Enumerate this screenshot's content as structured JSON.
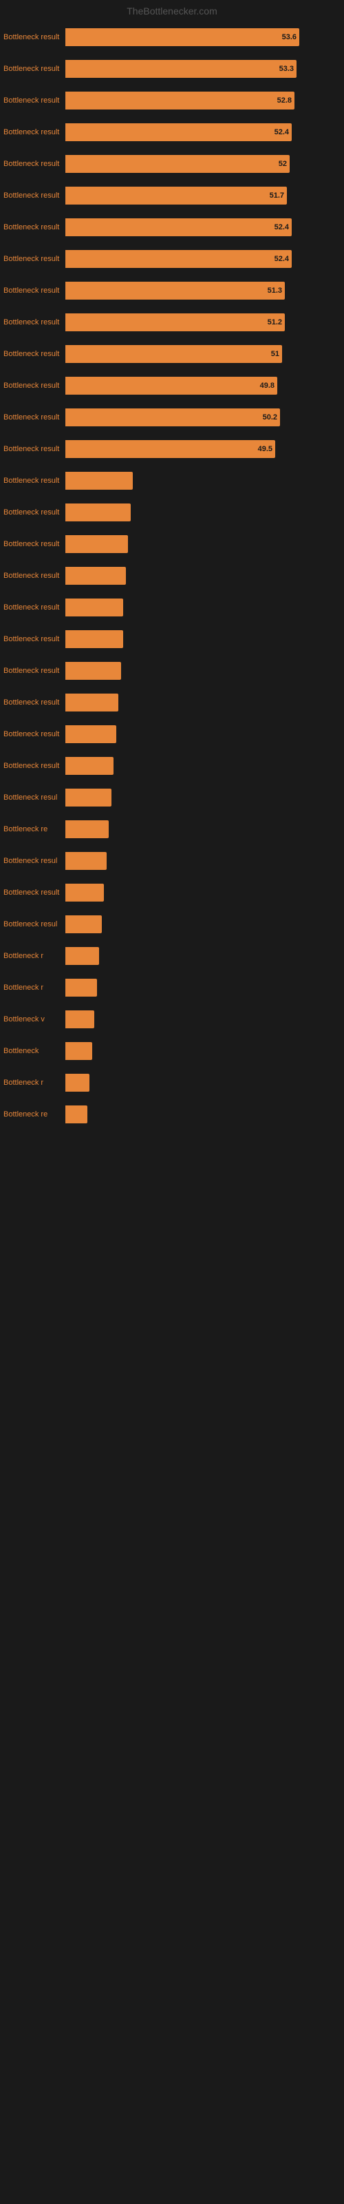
{
  "header": {
    "title": "TheBottlenecker.com"
  },
  "chart": {
    "max_width": 350,
    "bars": [
      {
        "label": "Bottleneck result",
        "value": 53.6,
        "width_pct": 0.97
      },
      {
        "label": "Bottleneck result",
        "value": 53.3,
        "width_pct": 0.96
      },
      {
        "label": "Bottleneck result",
        "value": 52.8,
        "width_pct": 0.95
      },
      {
        "label": "Bottleneck result",
        "value": 52.4,
        "width_pct": 0.94
      },
      {
        "label": "Bottleneck result",
        "value": 52.0,
        "width_pct": 0.93
      },
      {
        "label": "Bottleneck result",
        "value": 51.7,
        "width_pct": 0.92
      },
      {
        "label": "Bottleneck result",
        "value": 52.4,
        "width_pct": 0.94
      },
      {
        "label": "Bottleneck result",
        "value": 52.4,
        "width_pct": 0.94
      },
      {
        "label": "Bottleneck result",
        "value": 51.3,
        "width_pct": 0.91
      },
      {
        "label": "Bottleneck result",
        "value": 51.2,
        "width_pct": 0.91
      },
      {
        "label": "Bottleneck result",
        "value": 51.0,
        "width_pct": 0.9
      },
      {
        "label": "Bottleneck result",
        "value": 49.8,
        "width_pct": 0.88
      },
      {
        "label": "Bottleneck result",
        "value": 50.2,
        "width_pct": 0.89
      },
      {
        "label": "Bottleneck result",
        "value": 49.5,
        "width_pct": 0.87
      },
      {
        "label": "Bottleneck result",
        "value": null,
        "width_pct": 0.28
      },
      {
        "label": "Bottleneck result",
        "value": null,
        "width_pct": 0.27
      },
      {
        "label": "Bottleneck result",
        "value": null,
        "width_pct": 0.26
      },
      {
        "label": "Bottleneck result",
        "value": null,
        "width_pct": 0.25
      },
      {
        "label": "Bottleneck result",
        "value": null,
        "width_pct": 0.24
      },
      {
        "label": "Bottleneck result",
        "value": null,
        "width_pct": 0.24
      },
      {
        "label": "Bottleneck result",
        "value": null,
        "width_pct": 0.23
      },
      {
        "label": "Bottleneck result",
        "value": null,
        "width_pct": 0.22
      },
      {
        "label": "Bottleneck result",
        "value": null,
        "width_pct": 0.21
      },
      {
        "label": "Bottleneck result",
        "value": null,
        "width_pct": 0.2
      },
      {
        "label": "Bottleneck resul",
        "value": null,
        "width_pct": 0.19
      },
      {
        "label": "Bottleneck re",
        "value": null,
        "width_pct": 0.18
      },
      {
        "label": "Bottleneck resul",
        "value": null,
        "width_pct": 0.17
      },
      {
        "label": "Bottleneck result",
        "value": null,
        "width_pct": 0.16
      },
      {
        "label": "Bottleneck resul",
        "value": null,
        "width_pct": 0.15
      },
      {
        "label": "Bottleneck r",
        "value": null,
        "width_pct": 0.14
      },
      {
        "label": "Bottleneck r",
        "value": null,
        "width_pct": 0.13
      },
      {
        "label": "Bottleneck v",
        "value": null,
        "width_pct": 0.12
      },
      {
        "label": "Bottleneck",
        "value": null,
        "width_pct": 0.11
      },
      {
        "label": "Bottleneck r",
        "value": null,
        "width_pct": 0.1
      },
      {
        "label": "Bottleneck re",
        "value": null,
        "width_pct": 0.09
      }
    ]
  }
}
